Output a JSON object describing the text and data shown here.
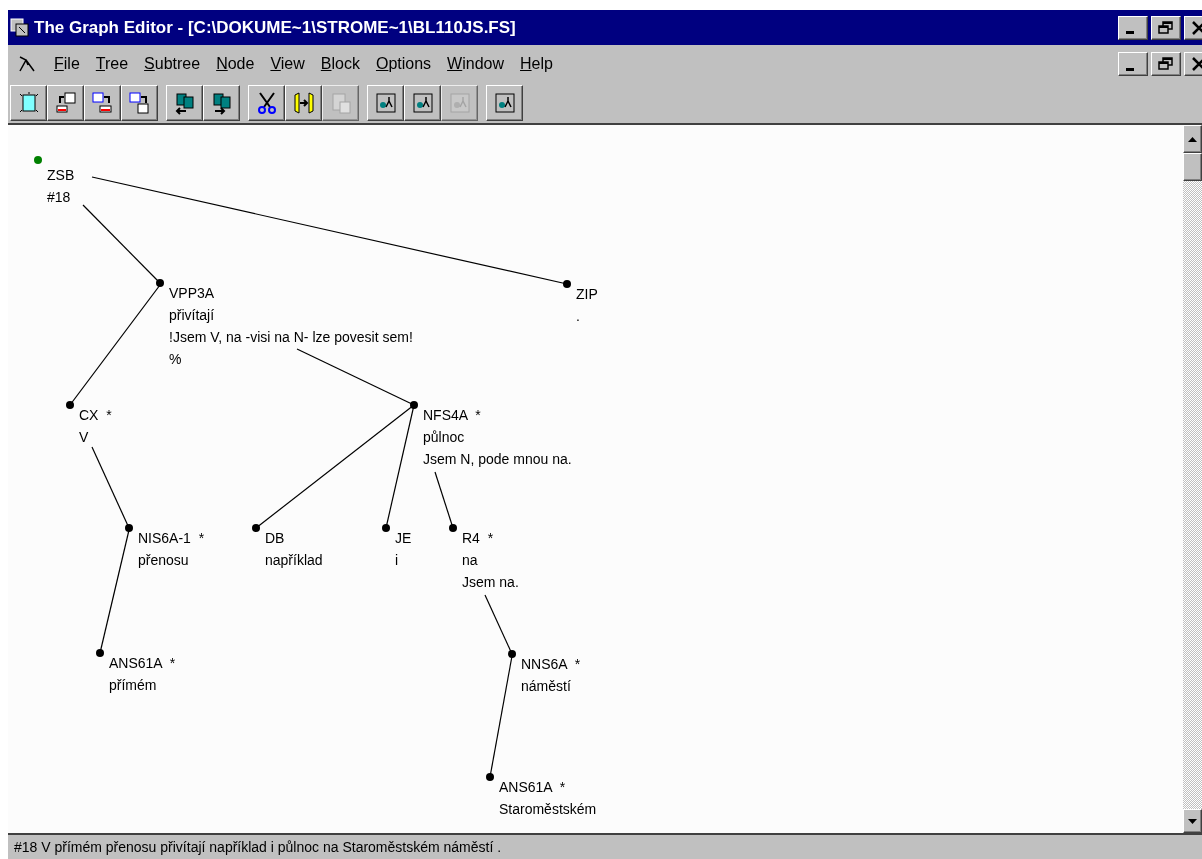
{
  "window": {
    "title": "The Graph Editor - [C:\\DOKUME~1\\STROME~1\\BL110JS.FS]"
  },
  "menu": [
    "File",
    "Tree",
    "Subtree",
    "Node",
    "View",
    "Block",
    "Options",
    "Window",
    "Help"
  ],
  "toolbar": [
    [
      {
        "kind": "new",
        "disabled": false
      },
      {
        "kind": "export",
        "disabled": false
      },
      {
        "kind": "import",
        "disabled": false
      },
      {
        "kind": "copy-page",
        "disabled": false
      }
    ],
    [
      {
        "kind": "move-left",
        "disabled": false
      },
      {
        "kind": "move-right",
        "disabled": false
      }
    ],
    [
      {
        "kind": "cut",
        "disabled": false
      },
      {
        "kind": "join",
        "disabled": false
      },
      {
        "kind": "paste",
        "disabled": true
      }
    ],
    [
      {
        "kind": "tree-a",
        "disabled": false
      },
      {
        "kind": "tree-b",
        "disabled": false
      },
      {
        "kind": "tree-c",
        "disabled": true
      }
    ],
    [
      {
        "kind": "tree-d",
        "disabled": false
      }
    ]
  ],
  "tree": {
    "lines": [
      "ZSB",
      "#18"
    ],
    "selected": true,
    "children": [
      {
        "lines": [
          "VPP3A",
          "přivítají",
          "!Jsem V, na -visi na N- lze povesit sem!",
          "%"
        ],
        "selected": false,
        "children": [
          {
            "lines": [
              "CX  *",
              "V"
            ],
            "selected": false,
            "children": [
              {
                "lines": [
                  "NIS6A-1  *",
                  "přenosu"
                ],
                "selected": false,
                "children": [
                  {
                    "lines": [
                      "ANS61A  *",
                      "přímém"
                    ],
                    "selected": false
                  }
                ]
              }
            ]
          },
          {
            "lines": [
              "NFS4A  *",
              "půlnoc",
              "Jsem N, pode mnou na."
            ],
            "selected": false,
            "children": [
              {
                "lines": [
                  "DB",
                  "například"
                ],
                "selected": false
              },
              {
                "lines": [
                  "JE",
                  "i"
                ],
                "selected": false
              },
              {
                "lines": [
                  "R4  *",
                  "na",
                  "Jsem na."
                ],
                "selected": false,
                "children": [
                  {
                    "lines": [
                      "NNS6A  *",
                      "náměstí"
                    ],
                    "selected": false,
                    "children": [
                      {
                        "lines": [
                          "ANS61A  *",
                          "Staroměstském"
                        ],
                        "selected": false
                      }
                    ]
                  }
                ]
              }
            ]
          }
        ]
      },
      {
        "lines": [
          "ZIP",
          "."
        ],
        "selected": false
      }
    ]
  },
  "status_bar": "#18 V přímém přenosu přivítají například i půlnoc na Staroměstském náměstí ."
}
